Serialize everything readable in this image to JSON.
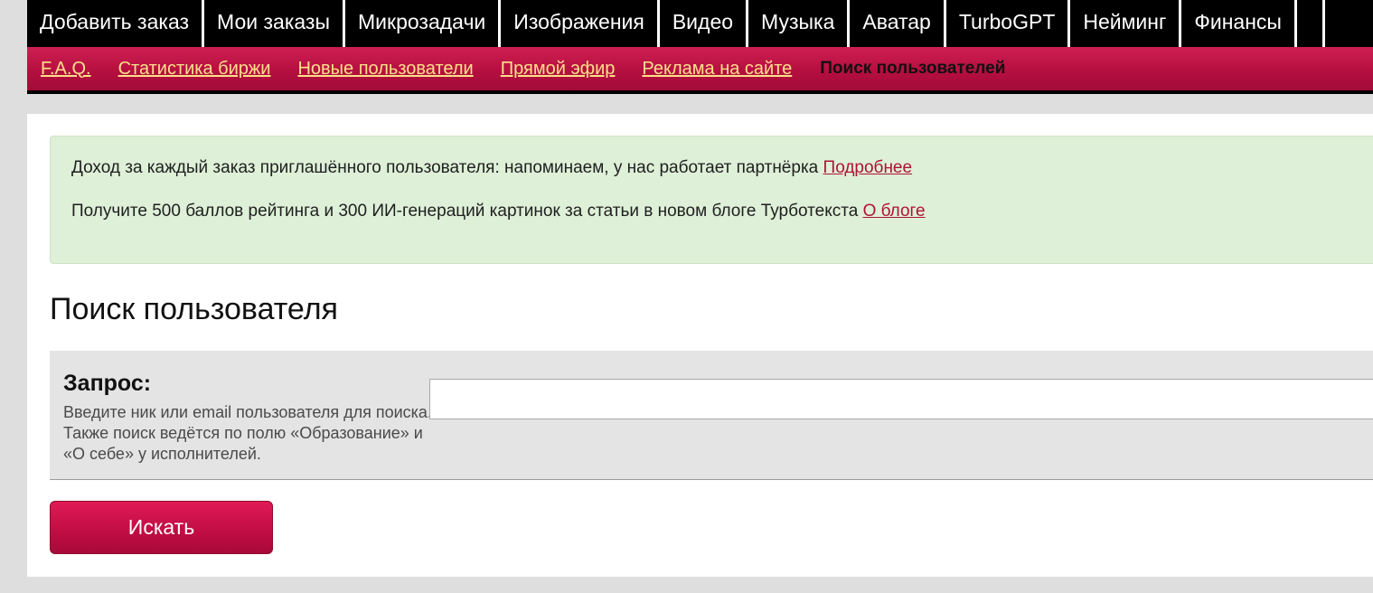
{
  "top_nav": {
    "tabs": [
      {
        "label": "Добавить заказ"
      },
      {
        "label": "Мои заказы"
      },
      {
        "label": "Микрозадачи"
      },
      {
        "label": "Изображения"
      },
      {
        "label": "Видео"
      },
      {
        "label": "Музыка"
      },
      {
        "label": "Аватар"
      },
      {
        "label": "TurboGPT"
      },
      {
        "label": "Нейминг"
      },
      {
        "label": "Финансы"
      }
    ]
  },
  "sub_nav": {
    "links": [
      {
        "label": "F.A.Q."
      },
      {
        "label": "Статистика биржи"
      },
      {
        "label": "Новые пользователи"
      },
      {
        "label": "Прямой эфир"
      },
      {
        "label": "Реклама на сайте"
      }
    ],
    "current": "Поиск пользователей"
  },
  "notice": {
    "line1_text": "Доход за каждый заказ приглашённого пользователя: напоминаем, у нас работает партнёрка ",
    "line1_link": "Подробнее",
    "line2_text": "Получите 500 баллов рейтинга и 300 ИИ-генераций картинок за статьи в новом блоге Турботекста ",
    "line2_link": "О блоге"
  },
  "page": {
    "title": "Поиск пользователя"
  },
  "form": {
    "query_label": "Запрос:",
    "query_hint": "Введите ник или email пользователя для поиска. Также поиск ведётся по полю «Образование» и «О себе» у исполнителей.",
    "query_value": "",
    "submit_label": "Искать"
  },
  "colors": {
    "accent": "#b50f3f",
    "subnav_link": "#fde08a",
    "notice_bg": "#def0d8",
    "topnav_bg": "#000000"
  }
}
